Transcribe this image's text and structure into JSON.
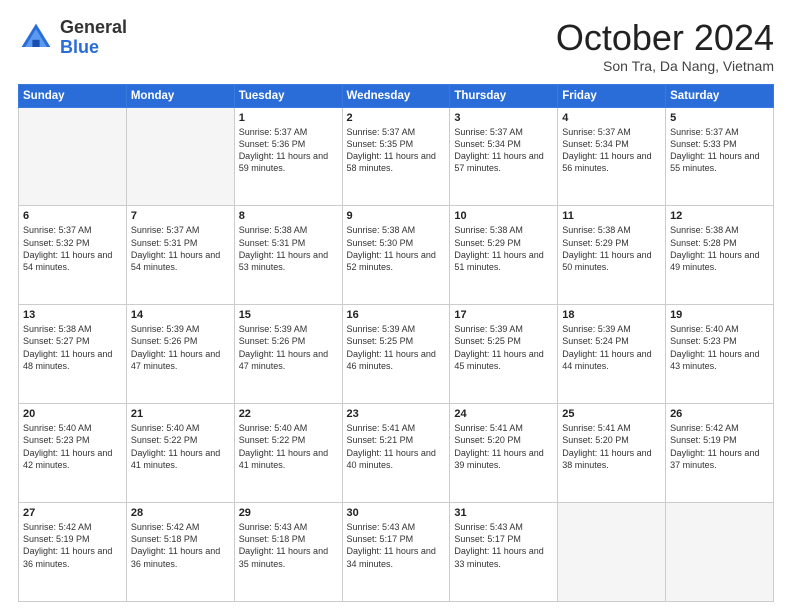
{
  "header": {
    "logo_general": "General",
    "logo_blue": "Blue",
    "month_title": "October 2024",
    "location": "Son Tra, Da Nang, Vietnam"
  },
  "weekdays": [
    "Sunday",
    "Monday",
    "Tuesday",
    "Wednesday",
    "Thursday",
    "Friday",
    "Saturday"
  ],
  "weeks": [
    [
      {
        "day": "",
        "text": ""
      },
      {
        "day": "",
        "text": ""
      },
      {
        "day": "1",
        "text": "Sunrise: 5:37 AM\nSunset: 5:36 PM\nDaylight: 11 hours\nand 59 minutes."
      },
      {
        "day": "2",
        "text": "Sunrise: 5:37 AM\nSunset: 5:35 PM\nDaylight: 11 hours\nand 58 minutes."
      },
      {
        "day": "3",
        "text": "Sunrise: 5:37 AM\nSunset: 5:34 PM\nDaylight: 11 hours\nand 57 minutes."
      },
      {
        "day": "4",
        "text": "Sunrise: 5:37 AM\nSunset: 5:34 PM\nDaylight: 11 hours\nand 56 minutes."
      },
      {
        "day": "5",
        "text": "Sunrise: 5:37 AM\nSunset: 5:33 PM\nDaylight: 11 hours\nand 55 minutes."
      }
    ],
    [
      {
        "day": "6",
        "text": "Sunrise: 5:37 AM\nSunset: 5:32 PM\nDaylight: 11 hours\nand 54 minutes."
      },
      {
        "day": "7",
        "text": "Sunrise: 5:37 AM\nSunset: 5:31 PM\nDaylight: 11 hours\nand 54 minutes."
      },
      {
        "day": "8",
        "text": "Sunrise: 5:38 AM\nSunset: 5:31 PM\nDaylight: 11 hours\nand 53 minutes."
      },
      {
        "day": "9",
        "text": "Sunrise: 5:38 AM\nSunset: 5:30 PM\nDaylight: 11 hours\nand 52 minutes."
      },
      {
        "day": "10",
        "text": "Sunrise: 5:38 AM\nSunset: 5:29 PM\nDaylight: 11 hours\nand 51 minutes."
      },
      {
        "day": "11",
        "text": "Sunrise: 5:38 AM\nSunset: 5:29 PM\nDaylight: 11 hours\nand 50 minutes."
      },
      {
        "day": "12",
        "text": "Sunrise: 5:38 AM\nSunset: 5:28 PM\nDaylight: 11 hours\nand 49 minutes."
      }
    ],
    [
      {
        "day": "13",
        "text": "Sunrise: 5:38 AM\nSunset: 5:27 PM\nDaylight: 11 hours\nand 48 minutes."
      },
      {
        "day": "14",
        "text": "Sunrise: 5:39 AM\nSunset: 5:26 PM\nDaylight: 11 hours\nand 47 minutes."
      },
      {
        "day": "15",
        "text": "Sunrise: 5:39 AM\nSunset: 5:26 PM\nDaylight: 11 hours\nand 47 minutes."
      },
      {
        "day": "16",
        "text": "Sunrise: 5:39 AM\nSunset: 5:25 PM\nDaylight: 11 hours\nand 46 minutes."
      },
      {
        "day": "17",
        "text": "Sunrise: 5:39 AM\nSunset: 5:25 PM\nDaylight: 11 hours\nand 45 minutes."
      },
      {
        "day": "18",
        "text": "Sunrise: 5:39 AM\nSunset: 5:24 PM\nDaylight: 11 hours\nand 44 minutes."
      },
      {
        "day": "19",
        "text": "Sunrise: 5:40 AM\nSunset: 5:23 PM\nDaylight: 11 hours\nand 43 minutes."
      }
    ],
    [
      {
        "day": "20",
        "text": "Sunrise: 5:40 AM\nSunset: 5:23 PM\nDaylight: 11 hours\nand 42 minutes."
      },
      {
        "day": "21",
        "text": "Sunrise: 5:40 AM\nSunset: 5:22 PM\nDaylight: 11 hours\nand 41 minutes."
      },
      {
        "day": "22",
        "text": "Sunrise: 5:40 AM\nSunset: 5:22 PM\nDaylight: 11 hours\nand 41 minutes."
      },
      {
        "day": "23",
        "text": "Sunrise: 5:41 AM\nSunset: 5:21 PM\nDaylight: 11 hours\nand 40 minutes."
      },
      {
        "day": "24",
        "text": "Sunrise: 5:41 AM\nSunset: 5:20 PM\nDaylight: 11 hours\nand 39 minutes."
      },
      {
        "day": "25",
        "text": "Sunrise: 5:41 AM\nSunset: 5:20 PM\nDaylight: 11 hours\nand 38 minutes."
      },
      {
        "day": "26",
        "text": "Sunrise: 5:42 AM\nSunset: 5:19 PM\nDaylight: 11 hours\nand 37 minutes."
      }
    ],
    [
      {
        "day": "27",
        "text": "Sunrise: 5:42 AM\nSunset: 5:19 PM\nDaylight: 11 hours\nand 36 minutes."
      },
      {
        "day": "28",
        "text": "Sunrise: 5:42 AM\nSunset: 5:18 PM\nDaylight: 11 hours\nand 36 minutes."
      },
      {
        "day": "29",
        "text": "Sunrise: 5:43 AM\nSunset: 5:18 PM\nDaylight: 11 hours\nand 35 minutes."
      },
      {
        "day": "30",
        "text": "Sunrise: 5:43 AM\nSunset: 5:17 PM\nDaylight: 11 hours\nand 34 minutes."
      },
      {
        "day": "31",
        "text": "Sunrise: 5:43 AM\nSunset: 5:17 PM\nDaylight: 11 hours\nand 33 minutes."
      },
      {
        "day": "",
        "text": ""
      },
      {
        "day": "",
        "text": ""
      }
    ]
  ]
}
